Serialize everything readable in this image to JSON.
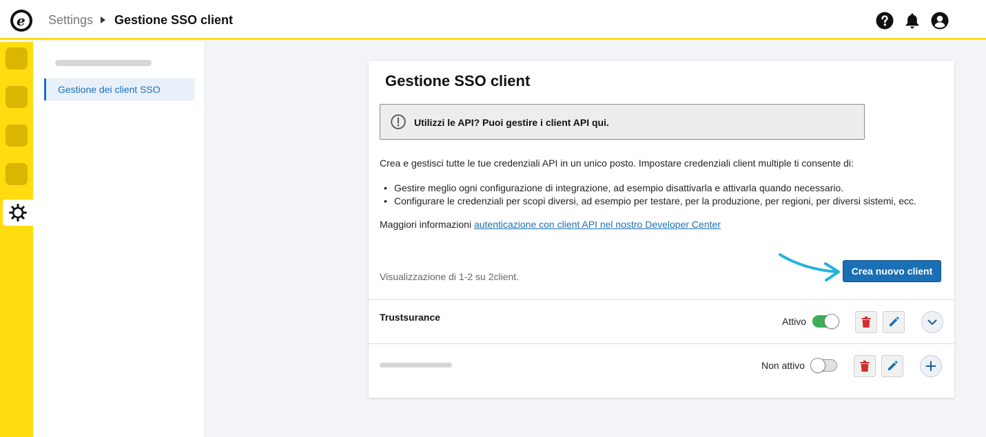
{
  "header": {
    "logo_letter": "e",
    "breadcrumb": {
      "parent": "Settings",
      "current": "Gestione SSO client"
    },
    "icons": [
      "help-icon",
      "bell-icon",
      "user-icon"
    ]
  },
  "rail": {
    "items": [
      "rail-item-1",
      "rail-item-2",
      "rail-item-3",
      "rail-item-4"
    ],
    "active_icon": "gear-icon",
    "colors": {
      "background": "#ffdc0f",
      "item": "#d9b600"
    }
  },
  "subnav": {
    "items": [
      {
        "label": "Gestione dei client SSO",
        "active": true
      }
    ]
  },
  "main": {
    "title": "Gestione SSO client",
    "notice": "Utilizzi le API? Puoi gestire i client API qui.",
    "intro": "Crea e gestisci tutte le tue credenziali API in un unico posto. Impostare credenziali client multiple ti consente di:",
    "bullets": [
      "Gestire meglio ogni configurazione di integrazione, ad esempio disattivarla e attivarla quando necessario.",
      "Configurare le credenziali per scopi diversi, ad esempio per testare, per la produzione, per regioni, per diversi sistemi, ecc."
    ],
    "more_info": {
      "prefix": "Maggiori informazioni",
      "link": "autenticazione con client API nel nostro Developer Center"
    },
    "count_text": "Visualizzazione di 1-2 su 2client.",
    "create_button": "Crea nuovo client",
    "clients": [
      {
        "name": "Trustsurance",
        "status": "Attivo",
        "active": true,
        "expand_icon": "chevron-down-icon"
      },
      {
        "name": "",
        "status": "Non attivo",
        "active": false,
        "expand_icon": "plus-icon"
      }
    ]
  },
  "colors": {
    "accent": "#1a6fb5",
    "brand_yellow": "#ffdc0f",
    "toggle_on": "#3fae5a",
    "delete": "#d32f2f",
    "annotation_arrow": "#22b2dc"
  }
}
